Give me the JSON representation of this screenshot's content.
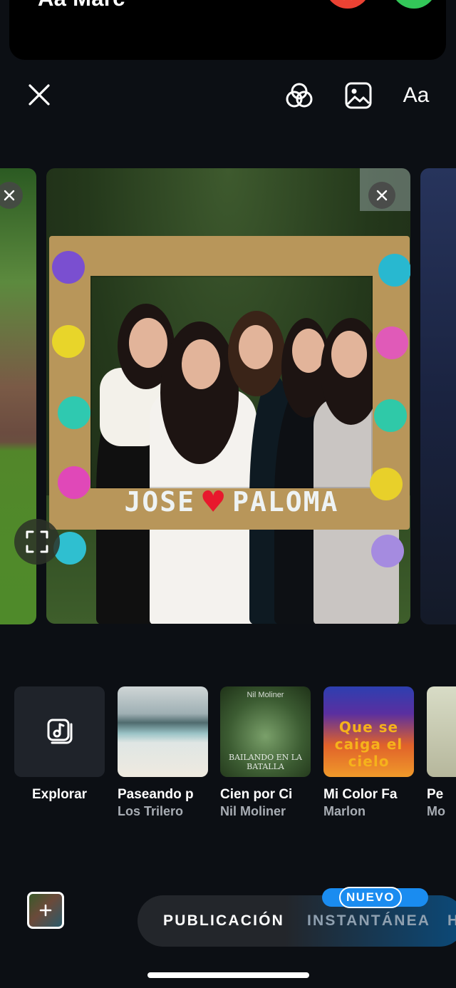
{
  "call": {
    "caller_name": "Aa Marc"
  },
  "toolbar": {
    "text_tool_label": "Aa"
  },
  "photo": {
    "frame_left_word": "JOSE",
    "frame_right_word": "PALOMA"
  },
  "music": {
    "explore_label": "Explorar",
    "tracks": [
      {
        "title": "Paseando p",
        "artist": "Los Trilero",
        "cover_caption": ""
      },
      {
        "title": "Cien por Ci",
        "artist": "Nil Moliner",
        "cover_top": "Nil Moliner",
        "cover_caption": "BAILANDO EN LA BATALLA"
      },
      {
        "title": "Mi Color Fa",
        "artist": "Marlon",
        "cover_caption": "Que se caiga el cielo"
      },
      {
        "title": "Pe",
        "artist": "Mo"
      }
    ]
  },
  "modes": {
    "active": "PUBLICACIÓN",
    "other": "INSTANTÁNEA",
    "more": "H",
    "badge": "NUEVO"
  },
  "colors": {
    "decline": "#eb4233",
    "accept": "#33c759",
    "badge": "#1a8cf0"
  }
}
